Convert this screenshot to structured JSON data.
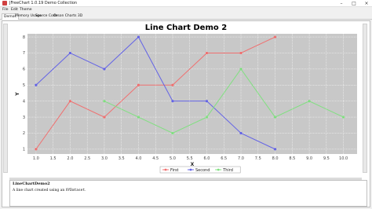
{
  "window": {
    "title": "JFreeChart 1.0.19 Demo Collection",
    "minimize": "–",
    "maximize": "□",
    "close": "×"
  },
  "menu": [
    "File",
    "Edit",
    "Theme"
  ],
  "tabs": [
    "Demos",
    "Memory Usage",
    "Source Code",
    "Orson Charts 3D"
  ],
  "active_tab": "Demos",
  "chart_data": {
    "type": "line",
    "title": "Line Chart Demo 2",
    "xlabel": "X",
    "ylabel": "Y",
    "xlim": [
      0.75,
      10.4
    ],
    "ylim": [
      0.7,
      8.2
    ],
    "xticks": [
      "1.0",
      "1.5",
      "2.0",
      "2.5",
      "3.0",
      "3.5",
      "4.0",
      "4.5",
      "5.0",
      "5.5",
      "6.0",
      "6.5",
      "7.0",
      "7.5",
      "8.0",
      "8.5",
      "9.0",
      "9.5",
      "10.0"
    ],
    "yticks": [
      "1",
      "2",
      "3",
      "4",
      "5",
      "6",
      "7",
      "8"
    ],
    "grid": true,
    "legend": "bottom",
    "series": [
      {
        "name": "First",
        "color": "#f07070",
        "x": [
          1,
          2,
          3,
          4,
          5,
          6,
          7,
          8
        ],
        "y": [
          1,
          4,
          3,
          5,
          5,
          7,
          7,
          8
        ]
      },
      {
        "name": "Second",
        "color": "#6464e6",
        "x": [
          1,
          2,
          3,
          4,
          5,
          6,
          7,
          8
        ],
        "y": [
          5,
          7,
          6,
          8,
          4,
          4,
          2,
          1
        ]
      },
      {
        "name": "Third",
        "color": "#80e080",
        "x": [
          3,
          4,
          5,
          6,
          7,
          8,
          9,
          10
        ],
        "y": [
          4,
          3,
          2,
          3,
          6,
          3,
          4,
          3
        ]
      }
    ]
  },
  "description": {
    "title": "LineChartDemo2",
    "body_prefix": "A line chart created using an ",
    "body_code": "XYDataset",
    "body_suffix": "."
  }
}
